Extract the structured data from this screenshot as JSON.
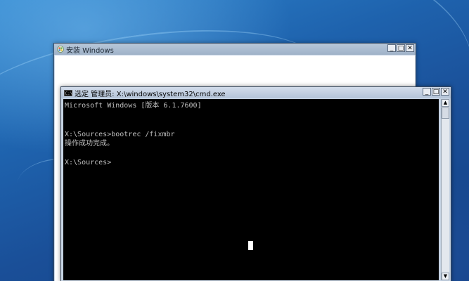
{
  "setup_window": {
    "title": "安装 Windows",
    "buttons": {
      "minimize": "_",
      "maximize": "□",
      "close": "✕"
    }
  },
  "cmd_window": {
    "title": "选定 管理员: X:\\windows\\system32\\cmd.exe",
    "icon": "console-icon",
    "buttons": {
      "minimize": "_",
      "maximize": "□",
      "close": "✕"
    },
    "console_lines": [
      "Microsoft Windows [版本 6.1.7600]",
      "",
      "",
      "X:\\Sources>bootrec /fixmbr",
      "操作成功完成。",
      "",
      "X:\\Sources>"
    ],
    "scrollbar": {
      "up": "▲",
      "down": "▼"
    }
  },
  "colors": {
    "console_background": "#000000",
    "console_text": "#c0c0c0",
    "desktop_blue": "#1e62ad"
  }
}
